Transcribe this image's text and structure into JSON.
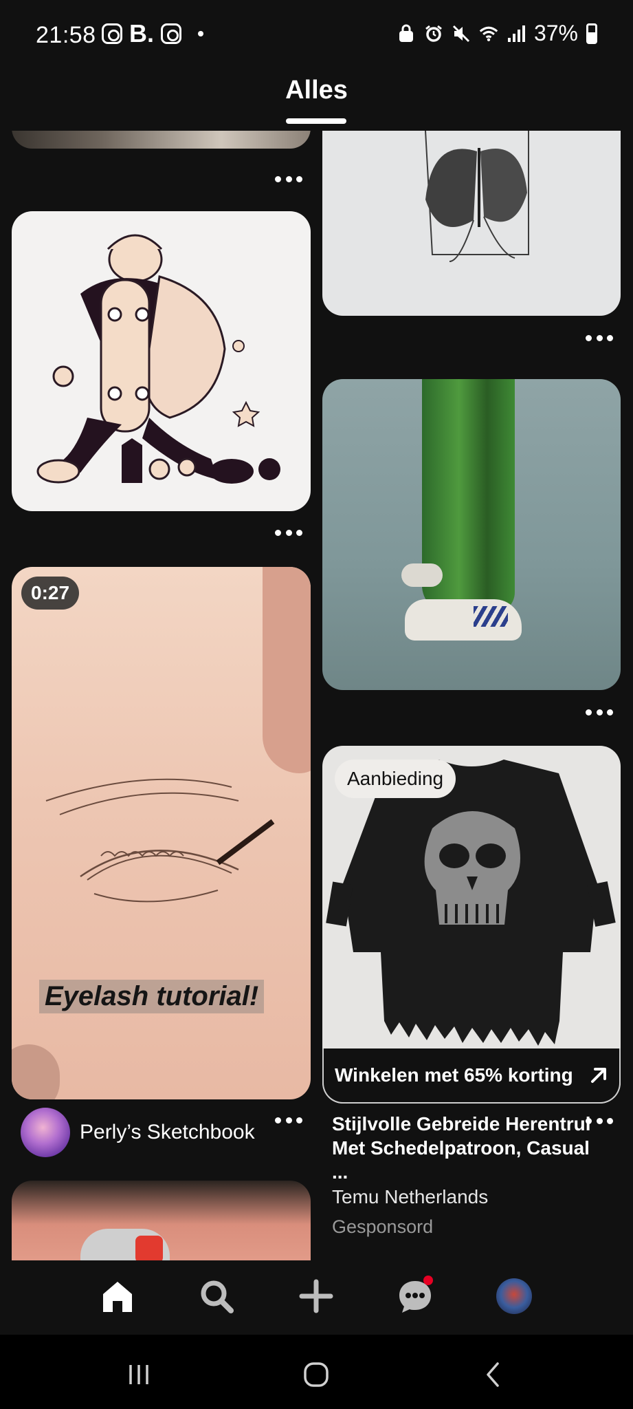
{
  "status_bar": {
    "time": "21:58",
    "left_icons": [
      "instagram-icon",
      "booking-b-icon",
      "instagram-icon",
      "dot-icon"
    ],
    "b_glyph": "B.",
    "battery": "37%",
    "right_icons": [
      "lock-icon",
      "alarm-icon",
      "mute-icon",
      "wifi-icon",
      "signal-icon",
      "battery-icon"
    ]
  },
  "tabs": {
    "active": "Alles"
  },
  "feed": {
    "left_column": [
      {
        "kind": "image",
        "subject": "cropped photo"
      },
      {
        "kind": "image",
        "subject": "illustration boy with skateboard"
      },
      {
        "kind": "video",
        "duration": "0:27",
        "overlay_text": "Eyelash tutorial!",
        "creator": "Perly’s Sketchbook"
      },
      {
        "kind": "image",
        "subject": "hand holding small skull charm"
      }
    ],
    "right_column": [
      {
        "kind": "image",
        "subject": "butterfly print"
      },
      {
        "kind": "image",
        "subject": "painting green trousers sneakers"
      },
      {
        "kind": "promoted",
        "badge": "Aanbieding",
        "shop_label": "Winkelen met 65% korting",
        "title": "Stijlvolle Gebreide Herentrui Met Schedelpatroon, Casual ...",
        "advertiser": "Temu Netherlands",
        "sponsored_label": "Gesponsord"
      }
    ]
  },
  "bottom_nav": {
    "items": [
      "home-icon",
      "search-icon",
      "create-icon",
      "messages-icon",
      "profile-avatar"
    ],
    "accent_color": "#e60023"
  },
  "system_nav": {
    "items": [
      "recent-apps-icon",
      "home-circle-icon",
      "back-icon"
    ]
  }
}
